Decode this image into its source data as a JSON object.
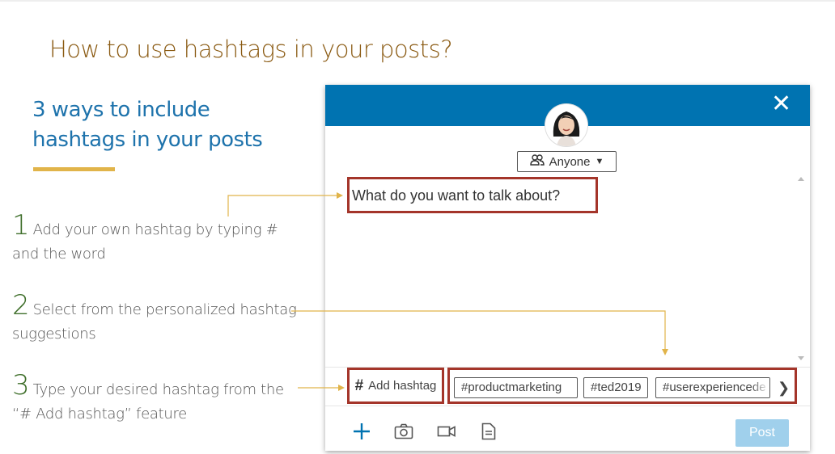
{
  "slide": {
    "title": "How to use hashtags in your posts?",
    "subheading": "3 ways to include hashtags in your posts",
    "steps": [
      {
        "number": "1",
        "text": "Add your own hashtag by typing # and the word"
      },
      {
        "number": "2",
        "text": "Select from the personalized hashtag suggestions"
      },
      {
        "number": "3",
        "text": "Type your desired hashtag from the “# Add hashtag” feature"
      }
    ]
  },
  "composer": {
    "audience_label": "Anyone",
    "prompt_placeholder": "What do you want to talk about?",
    "add_hashtag_label": "Add hashtag",
    "hashtag_suggestions": [
      "#productmarketing",
      "#ted2019",
      "#userexperiencede"
    ],
    "post_label": "Post",
    "icons": [
      "close-icon",
      "people-icon",
      "caret-down-icon",
      "hash-icon",
      "chevron-right-icon",
      "plus-icon",
      "camera-icon",
      "video-icon",
      "document-icon"
    ]
  },
  "colors": {
    "header_blue": "#0073b1",
    "title_brown": "#8a5a12",
    "subheading_blue": "#1e73ac",
    "highlight_red": "#a4352a",
    "accent_gold": "#e1b44a",
    "post_disabled": "#a0d0ec"
  }
}
